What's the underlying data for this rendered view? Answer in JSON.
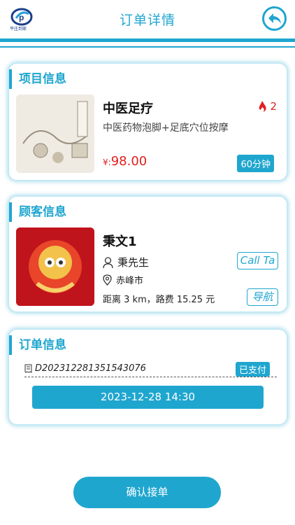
{
  "header": {
    "logo_text": "平庄到家",
    "title": "订单详情"
  },
  "project": {
    "section_title": "项目信息",
    "name": "中医足疗",
    "hot_count": "2",
    "description": "中医药物泡脚+足底穴位按摩",
    "price_symbol": "¥:",
    "price": "98.00",
    "duration": "60分钟"
  },
  "customer": {
    "section_title": "顾客信息",
    "name": "秉文1",
    "person": "秉先生",
    "city": "赤峰市",
    "distance_text": "距离 3 km，路费 15.25 元",
    "call_label": "Call Ta",
    "nav_label": "导航"
  },
  "order": {
    "section_title": "订单信息",
    "order_no": "D2023122813515​43076",
    "status": "已支付",
    "time": "2023-12-28 14:30"
  },
  "footer": {
    "confirm_label": "确认接单"
  },
  "colors": {
    "accent": "#1fa6cf",
    "price": "#e02020"
  }
}
